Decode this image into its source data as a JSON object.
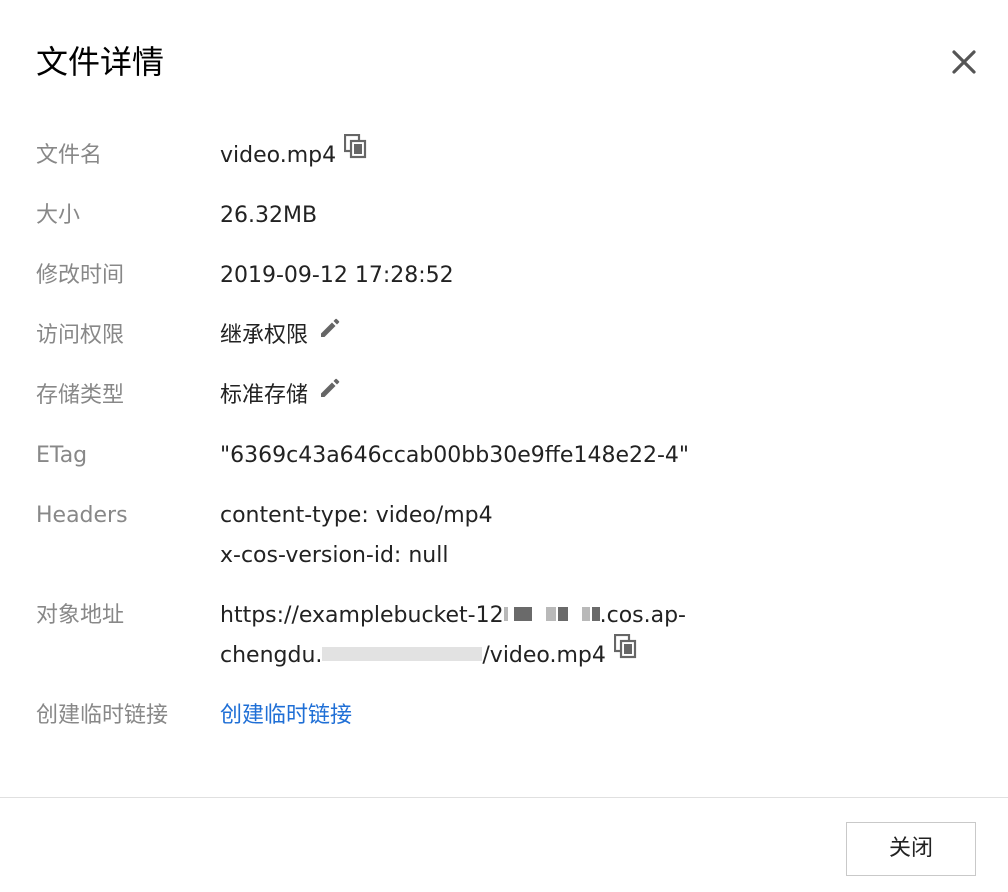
{
  "dialog": {
    "title": "文件详情",
    "close_icon": "close-icon"
  },
  "details": {
    "filename": {
      "label": "文件名",
      "value": "video.mp4",
      "icon": "copy-icon"
    },
    "size": {
      "label": "大小",
      "value": "26.32MB"
    },
    "modified": {
      "label": "修改时间",
      "value": "2019-09-12 17:28:52"
    },
    "acl": {
      "label": "访问权限",
      "value": "继承权限",
      "icon": "edit-icon"
    },
    "storage": {
      "label": "存储类型",
      "value": "标准存储",
      "icon": "edit-icon"
    },
    "etag": {
      "label": "ETag",
      "value": "\"6369c43a646ccab00bb30e9ffe148e22-4\""
    },
    "headers": {
      "label": "Headers",
      "lines": [
        "content-type: video/mp4",
        "x-cos-version-id: null"
      ]
    },
    "url": {
      "label": "对象地址",
      "line1_prefix": "https://examplebucket-12",
      "line1_suffix": ".cos.ap-",
      "line2_prefix": "chengdu.",
      "line2_suffix": "/video.mp4",
      "icon": "copy-icon"
    },
    "temp_link": {
      "label": "创建临时链接",
      "link_text": "创建临时链接"
    }
  },
  "footer": {
    "close_label": "关闭"
  }
}
